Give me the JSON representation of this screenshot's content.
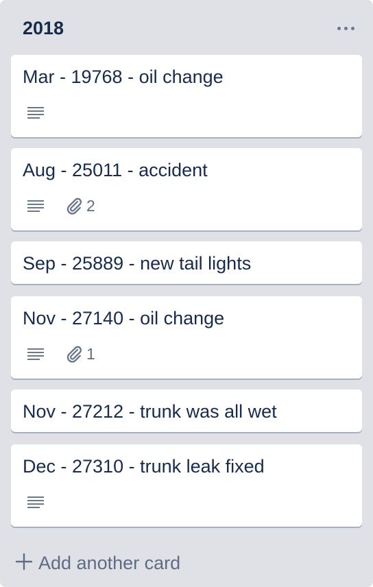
{
  "list": {
    "title": "2018",
    "menu_icon": "ellipsis-icon"
  },
  "cards": [
    {
      "title": "Mar - 19768 - oil change",
      "has_description": true,
      "attachments": ""
    },
    {
      "title": "Aug - 25011 - accident",
      "has_description": true,
      "attachments": "2"
    },
    {
      "title": "Sep - 25889 - new tail lights",
      "has_description": false,
      "attachments": ""
    },
    {
      "title": "Nov - 27140 - oil change",
      "has_description": true,
      "attachments": "1"
    },
    {
      "title": "Nov - 27212 - trunk was all wet",
      "has_description": false,
      "attachments": ""
    },
    {
      "title": "Dec - 27310 - trunk leak fixed",
      "has_description": true,
      "attachments": ""
    }
  ],
  "composer": {
    "add_label": "Add another card",
    "add_icon": "plus-icon"
  },
  "colors": {
    "list_bg": "#dfe1e6",
    "card_bg": "#ffffff",
    "text": "#172b4d",
    "muted": "#5e6c84"
  }
}
